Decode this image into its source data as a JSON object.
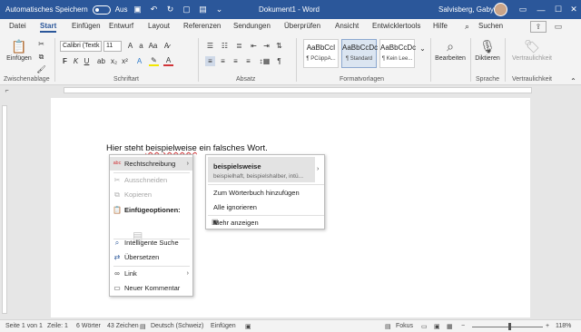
{
  "titlebar": {
    "autosave_label": "Automatisches Speichern",
    "autosave_state": "Aus",
    "doc_title": "Dokument1 - Word",
    "user_name": "Salvisberg, Gaby"
  },
  "tabs": [
    "Datei",
    "Start",
    "Einfügen",
    "Entwurf",
    "Layout",
    "Referenzen",
    "Sendungen",
    "Überprüfen",
    "Ansicht",
    "Entwicklertools",
    "Hilfe",
    "Suchen"
  ],
  "active_tab": "Start",
  "ribbon": {
    "paste_label": "Einfügen",
    "font_name": "Calibri (Textk",
    "font_size": "11",
    "styles": [
      {
        "sample": "AaBbCcI",
        "name": "¶ PCüppA..."
      },
      {
        "sample": "AaBbCcDc",
        "name": "¶ Standard"
      },
      {
        "sample": "AaBbCcDc",
        "name": "¶ Kein Lee..."
      }
    ],
    "edit_label": "Bearbeiten",
    "dictate_label": "Diktieren",
    "confidential_label": "Vertraulichkeit",
    "groups": {
      "clipboard": "Zwischenablage",
      "font": "Schriftart",
      "paragraph": "Absatz",
      "styles": "Formatvorlagen",
      "voice": "Sprache",
      "confidential": "Vertraulichkeit"
    },
    "accent_color": "#2b579a"
  },
  "document": {
    "text_before": "Hier steht ",
    "misspelled_word": "beispielweise",
    "text_after": " ein falsches Wort."
  },
  "context_menu": {
    "items": [
      {
        "label": "Rechtschreibung",
        "icon": "spellcheck-icon",
        "submenu": true,
        "highlighted": true
      },
      {
        "label": "Ausschneiden",
        "icon": "scissors-icon",
        "disabled": true
      },
      {
        "label": "Kopieren",
        "icon": "copy-icon",
        "disabled": true
      },
      {
        "label": "Einfügeoptionen:",
        "icon": "paste-icon",
        "bold": true
      },
      {
        "label": "Intelligente Suche",
        "icon": "search-icon"
      },
      {
        "label": "Übersetzen",
        "icon": "translate-icon"
      },
      {
        "label": "Link",
        "icon": "link-icon",
        "submenu": true
      },
      {
        "label": "Neuer Kommentar",
        "icon": "comment-icon"
      }
    ]
  },
  "spelling_submenu": {
    "suggestion": "beispielsweise",
    "alternatives": "beispielhaft, beispielshalber, intü...",
    "add_to_dictionary": "Zum Wörterbuch hinzufügen",
    "ignore_all": "Alle ignorieren",
    "show_more": "Mehr anzeigen"
  },
  "statusbar": {
    "page": "Seite 1 von 1",
    "line": "Zeile: 1",
    "words": "6 Wörter",
    "chars": "43 Zeichen",
    "language": "Deutsch (Schweiz)",
    "mode": "Einfügen",
    "focus": "Fokus",
    "zoom": "118%",
    "zoom_level": 118
  }
}
